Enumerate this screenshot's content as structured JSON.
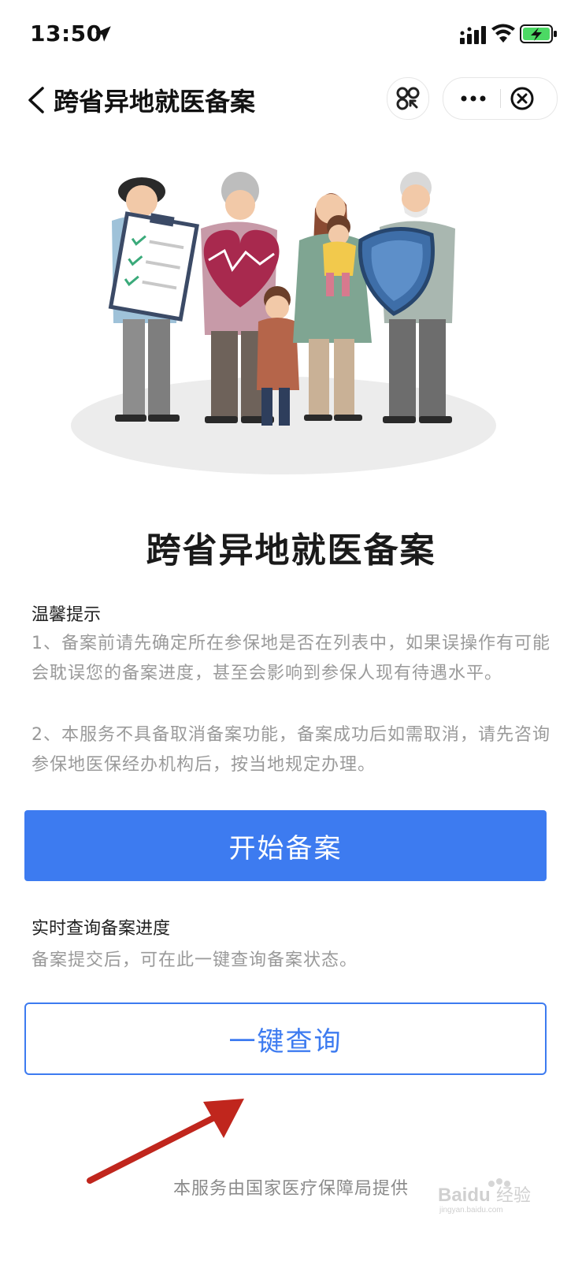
{
  "status_bar": {
    "time": "13:50",
    "battery_color": "#4cd964"
  },
  "nav": {
    "title": "跨省异地就医备案",
    "icons": [
      "back-icon",
      "scan-icon",
      "more-icon",
      "close-icon"
    ]
  },
  "hero": {
    "title": "跨省异地就医备案"
  },
  "tips": {
    "heading": "温馨提示",
    "items": [
      "1、备案前请先确定所在参保地是否在列表中，如果误操作有可能会耽误您的备案进度，甚至会影响到参保人现有待遇水平。",
      "2、本服务不具备取消备案功能，备案成功后如需取消，请先咨询参保地医保经办机构后，按当地规定办理。"
    ]
  },
  "start_button": {
    "label": "开始备案",
    "color": "#3d7bf0"
  },
  "query": {
    "heading": "实时查询备案进度",
    "description": "备案提交后，可在此一键查询备案状态。",
    "button_label": "一键查询"
  },
  "footer": {
    "text": "本服务由国家医疗保障局提供"
  },
  "watermark": {
    "text": "Baidu经验",
    "subtext": "jingyan.baidu.com"
  },
  "annotation_color": "#c0261d"
}
